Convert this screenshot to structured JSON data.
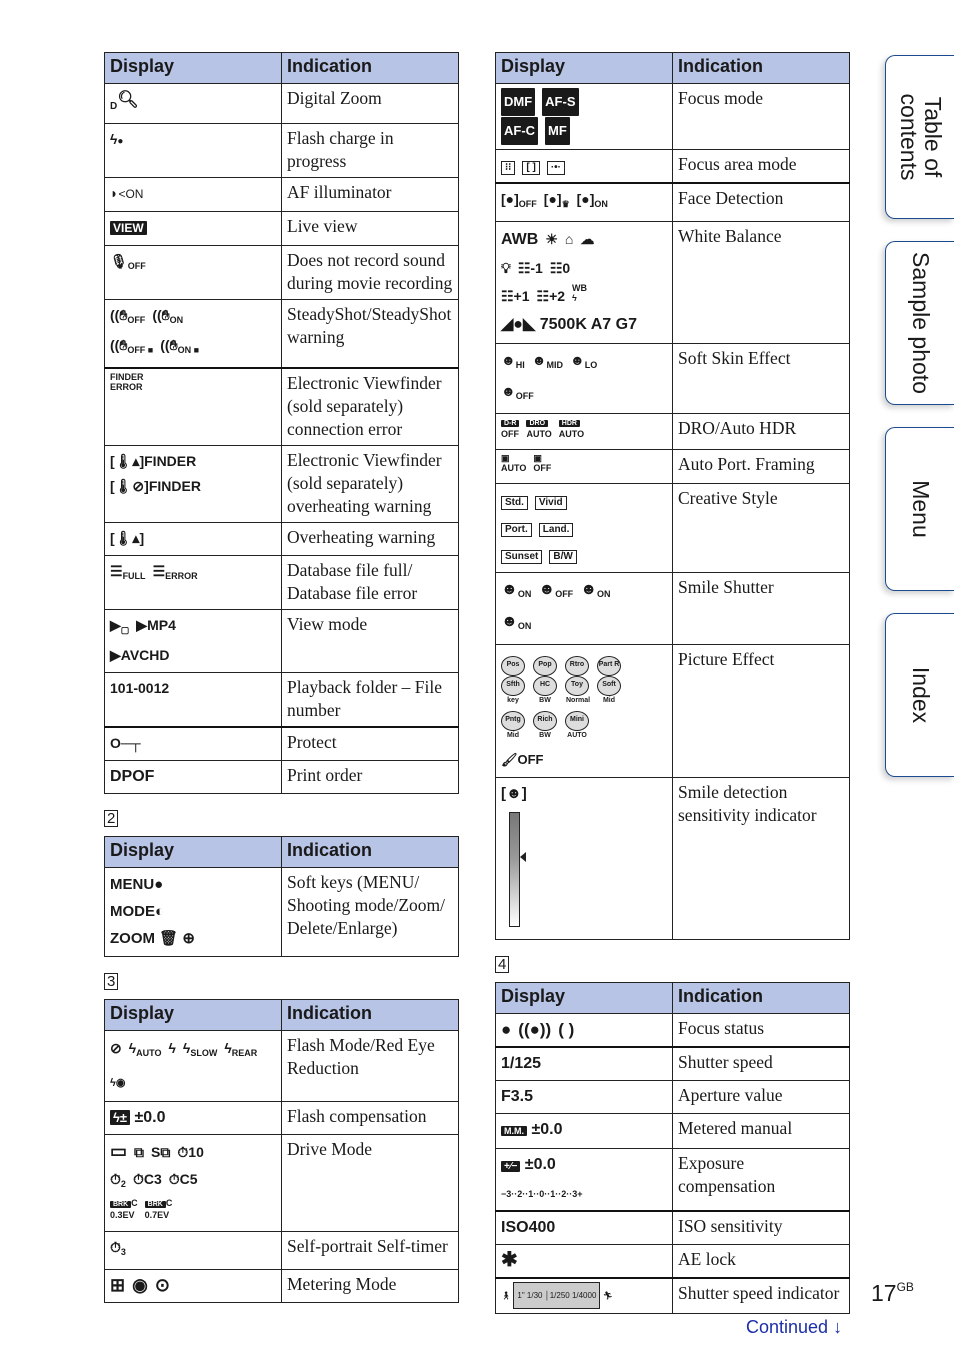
{
  "headers": {
    "display": "Display",
    "indication": "Indication"
  },
  "left_table_1": [
    {
      "display": [
        "ᴅ🔍"
      ],
      "indication": "Digital Zoom",
      "icon": "digital-zoom-icon"
    },
    {
      "display": [
        "⚡●"
      ],
      "indication": "Flash charge in progress",
      "icon": "flash-charge-icon"
    },
    {
      "display": [
        "◗⁼ON"
      ],
      "indication": "AF illuminator",
      "icon": "af-illuminator-icon"
    },
    {
      "display": [
        "VIEW"
      ],
      "indication": "Live view",
      "icon": "live-view-icon"
    },
    {
      "display": [
        "🎙OFF"
      ],
      "indication": "Does not record sound during movie recording",
      "icon": "mic-off-icon"
    },
    {
      "display": [
        "((✋OFF",
        "((✋ON",
        "((✋OFF!",
        "((✋ON!"
      ],
      "indication": "SteadyShot/SteadyShot warning",
      "icon": "steadyshot-icon"
    },
    {
      "display": [
        "FINDER ERROR"
      ],
      "indication": "Electronic Viewfinder (sold separately) connection error",
      "icon": "finder-error-icon"
    },
    {
      "display": [
        "[🌡]FINDER",
        "[🌡⊘]FINDER"
      ],
      "indication": "Electronic Viewfinder (sold separately) overheating warning",
      "icon": "finder-overheat-icon"
    },
    {
      "display": [
        "[🌡]"
      ],
      "indication": "Overheating warning",
      "icon": "overheat-icon"
    },
    {
      "display": [
        "≋FULL",
        "≋ERROR"
      ],
      "indication": "Database file full/ Database file error",
      "icon": "database-icon"
    },
    {
      "display": [
        "▶🖼",
        "▶MP4",
        "▶AVCHD"
      ],
      "indication": "View mode",
      "icon": "view-mode-icon"
    },
    {
      "display": [
        "101-0012"
      ],
      "indication": "Playback folder – File number",
      "icon": ""
    },
    {
      "display": [
        "O⊸"
      ],
      "indication": "Protect",
      "icon": "key-icon"
    },
    {
      "display": [
        "DPOF"
      ],
      "indication": "Print order",
      "icon": ""
    }
  ],
  "section_2": {
    "marker": "2",
    "rows": [
      {
        "display": [
          "MENU●",
          "MODE◐",
          "ZOOM 🗑 ⊕"
        ],
        "indication": "Soft keys (MENU/ Shooting mode/Zoom/ Delete/Enlarge)",
        "icon": "soft-keys-icon"
      }
    ]
  },
  "section_3": {
    "marker": "3",
    "rows": [
      {
        "display": [
          "⊘⚡",
          "⚡AUTO",
          "⚡",
          "⚡SLOW",
          "⚡REAR",
          "⚡👁"
        ],
        "indication": "Flash Mode/Red Eye Reduction",
        "icon": "flash-mode-icon"
      },
      {
        "display": [
          "⚡± ±0.0"
        ],
        "indication": "Flash compensation",
        "icon": "flash-compensation-icon"
      },
      {
        "display": [
          "□",
          "⧉",
          "S⧉",
          "⏱10",
          "⏱2",
          "⏱C3",
          "⏱C5",
          "BRK C 0.3EV",
          "BRK C 0.7EV"
        ],
        "indication": "Drive Mode",
        "icon": "drive-mode-icon"
      },
      {
        "display": [
          "⏱3"
        ],
        "indication": "Self-portrait Self-timer",
        "icon": "self-timer-icon"
      },
      {
        "display": [
          "⊞",
          "(•)",
          "[•]"
        ],
        "indication": "Metering Mode",
        "icon": "metering-icon"
      }
    ]
  },
  "right_table_1": [
    {
      "display": [
        "DMF",
        "AF-S",
        "AF-C",
        "MF"
      ],
      "indication": "Focus mode",
      "icon": "focus-mode-icon"
    },
    {
      "display": [
        "[⁚⁚]",
        "[ ]",
        "[·•·]"
      ],
      "indication": "Focus area mode",
      "icon": "focus-area-icon"
    },
    {
      "display": [
        "[●]OFF",
        "[●]♛",
        "[●]ON"
      ],
      "indication": "Face Detection",
      "icon": "face-detection-icon"
    },
    {
      "display": [
        "AWB",
        "☀",
        "⌂",
        "☁",
        "💡",
        "⚌-1",
        "⚌0",
        "⚌+1",
        "⚌+2",
        "WB⚡",
        "⛰ 7500K A7 G7"
      ],
      "indication": "White Balance",
      "icon": "white-balance-icon"
    },
    {
      "display": [
        "☺HI",
        "☺MID",
        "☺LO",
        "☺OFF"
      ],
      "indication": "Soft Skin Effect",
      "icon": "soft-skin-icon"
    },
    {
      "display": [
        "D-R OFF",
        "DRO AUTO",
        "HDR AUTO"
      ],
      "indication": "DRO/Auto HDR",
      "icon": "dro-hdr-icon"
    },
    {
      "display": [
        "⊡AUTO",
        "⊡OFF"
      ],
      "indication": "Auto Port. Framing",
      "icon": "auto-framing-icon"
    },
    {
      "display": [
        "Std.",
        "Vivid",
        "Port.",
        "Land.",
        "Sunset",
        "B/W"
      ],
      "indication": "Creative Style",
      "icon": "creative-style-icon"
    },
    {
      "display": [
        "☻ON",
        "☻OFF",
        "☻ON",
        "☻ON"
      ],
      "indication": "Smile Shutter",
      "icon": "smile-shutter-icon"
    },
    {
      "display": [
        "Pos",
        "Pop",
        "Rtro",
        "Part R",
        "Sfth key",
        "HC BW",
        "Toy Normal",
        "Soft Mid",
        "Pntg Mid",
        "Rich BW",
        "Mini AUTO",
        "🖌OFF"
      ],
      "indication": "Picture Effect",
      "icon": "picture-effect-icon"
    },
    {
      "display": [
        "[☻]"
      ],
      "indication": "Smile detection sensitivity indicator",
      "icon": "smile-sensitivity-icon",
      "level": 0.6
    }
  ],
  "section_4": {
    "marker": "4",
    "rows": [
      {
        "display": [
          "●",
          "((●))",
          "( )"
        ],
        "indication": "Focus status",
        "icon": "focus-status-icon"
      },
      {
        "display": [
          "1/125"
        ],
        "indication": "Shutter speed",
        "icon": ""
      },
      {
        "display": [
          "F3.5"
        ],
        "indication": "Aperture value",
        "icon": ""
      },
      {
        "display": [
          "M.M. ±0.0"
        ],
        "indication": "Metered manual",
        "icon": "metered-manual-icon"
      },
      {
        "display": [
          "⁺∕₋ ±0.0",
          "−3··2··1··0··1··2··3+"
        ],
        "indication": "Exposure compensation",
        "icon": "exposure-comp-icon"
      },
      {
        "display": [
          "ISO400"
        ],
        "indication": "ISO sensitivity",
        "icon": ""
      },
      {
        "display": [
          "✱"
        ],
        "indication": "AE lock",
        "icon": "ae-lock-icon"
      },
      {
        "display": [
          "🚶 1\" 1/30 | 1/250 1/4000 🏃"
        ],
        "indication": "Shutter speed indicator",
        "icon": "shutter-indicator-icon"
      }
    ]
  },
  "side_tabs": [
    {
      "label": "Table of\ncontents"
    },
    {
      "label": "Sample photo"
    },
    {
      "label": "Menu"
    },
    {
      "label": "Index"
    }
  ],
  "footer": {
    "page_number": "17",
    "page_suffix": "GB",
    "continued": "Continued",
    "continued_arrow": "↓"
  },
  "colors": {
    "header_bg": "#b7c4e6",
    "tab_border": "#1c4a8e",
    "link": "#1a2ea8"
  }
}
